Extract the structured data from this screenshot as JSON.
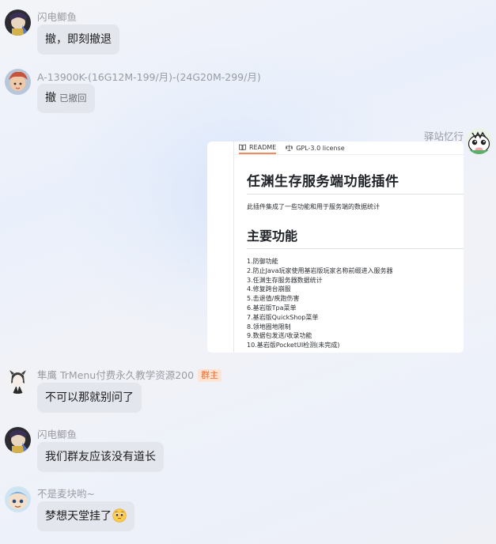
{
  "messages": [
    {
      "sender": "闪电鲫鱼",
      "text": "撤，即刻撤退"
    },
    {
      "sender": "A-13900K-(16G12M-199/月)-(24G20M-299/月)",
      "text": "撤",
      "recall_note": "已撤回"
    },
    {
      "sender": "驿站忆行"
    },
    {
      "sender": "隼鹰 TrMenu付费永久教学资源200",
      "badge": "群主",
      "text": "不可以那就别问了"
    },
    {
      "sender": "闪电鲫鱼",
      "text": "我们群友应该没有道长"
    },
    {
      "sender": "不是麦块哟~",
      "text": "梦想天堂挂了"
    }
  ],
  "shared_image": {
    "tabs": [
      "README",
      "GPL-3.0 license"
    ],
    "title": "任渊生存服务端功能插件",
    "description": "此插件集成了一些功能和用于服务端的数据统计",
    "section_title": "主要功能",
    "features": [
      "1.防御功能",
      "2.防止Java玩家使用基岩版玩家名称前缀进入服务器",
      "3.任渊生存服务器数据统计",
      "4.修复跨台崩服",
      "5.击退值/疾跑伤害",
      "6.基岩版Tpa菜单",
      "7.基岩版QuickShop菜单",
      "8.领地圈地限制",
      "9.数据包发送/收录功能",
      "10.基岩版PocketUI检测(未完成)"
    ]
  },
  "icons": {
    "emoji_after_last": "pleading-face-icon",
    "readme_tab": "book-icon",
    "license_tab": "scale-icon"
  },
  "colors": {
    "bubble": "#e4e6ed",
    "owner_badge_bg": "#fde4d4",
    "owner_badge_text": "#f26b2d",
    "sender_text": "#9a9ba3"
  }
}
